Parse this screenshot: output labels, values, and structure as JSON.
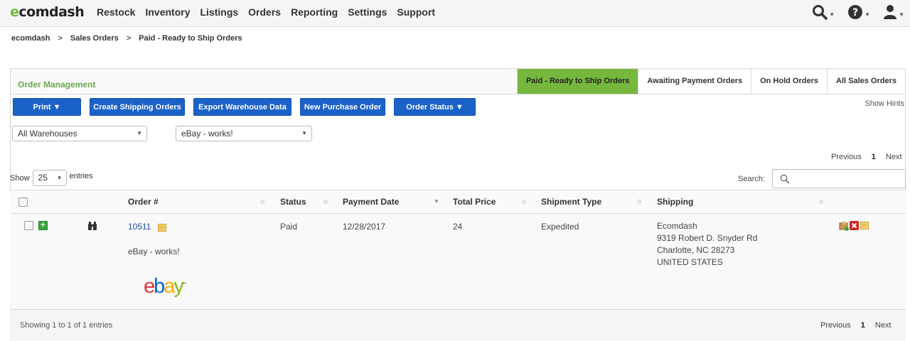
{
  "app": {
    "logo_prefix": "e",
    "logo_rest": "comdash"
  },
  "nav": {
    "items": [
      "Restock",
      "Inventory",
      "Listings",
      "Orders",
      "Reporting",
      "Settings",
      "Support"
    ],
    "icons": [
      "search-icon",
      "help-icon",
      "user-icon"
    ]
  },
  "breadcrumb": [
    "ecomdash",
    "Sales Orders",
    "Paid - Ready to Ship Orders"
  ],
  "panel": {
    "title": "Order Management",
    "tabs": [
      "Paid - Ready to Ship Orders",
      "Awaiting Payment Orders",
      "On Hold Orders",
      "All Sales Orders"
    ],
    "active_tab": 0
  },
  "toolbar": {
    "print": "Print ▼",
    "create_shipping": "Create Shipping Orders",
    "export_warehouse": "Export Warehouse Data",
    "new_purchase": "New Purchase Order",
    "order_status": "Order Status ▼",
    "show_hints": "Show Hints"
  },
  "filters": {
    "warehouse": "All Warehouses",
    "channel": "eBay - works!"
  },
  "pagination": {
    "previous": "Previous",
    "current": "1",
    "next": "Next"
  },
  "length": {
    "show": "Show",
    "value": "25",
    "entries": "entries"
  },
  "search": {
    "label": "Search:",
    "value": ""
  },
  "table": {
    "columns": [
      "Order #",
      "Status",
      "Payment Date",
      "Total Price",
      "Shipment Type",
      "Shipping"
    ],
    "rows": [
      {
        "order_no": "10511",
        "channel": "eBay - works!",
        "status": "Paid",
        "payment_date": "12/28/2017",
        "total_price": "24",
        "shipment_type": "Expedited",
        "shipping": [
          "Ecomdash",
          "9319 Robert D. Snyder Rd",
          "Charlotte, NC 28273",
          "UNITED STATES"
        ]
      }
    ]
  },
  "logo_ebay": {
    "e": "e",
    "b": "b",
    "a": "a",
    "y": "y"
  },
  "footer": {
    "showing": "Showing 1 to 1 of 1 entries"
  },
  "colors": {
    "brand_green": "#6cbb3c",
    "active_tab": "#76b73e",
    "button_blue": "#1a62c8",
    "link_blue": "#1a4fa0"
  }
}
